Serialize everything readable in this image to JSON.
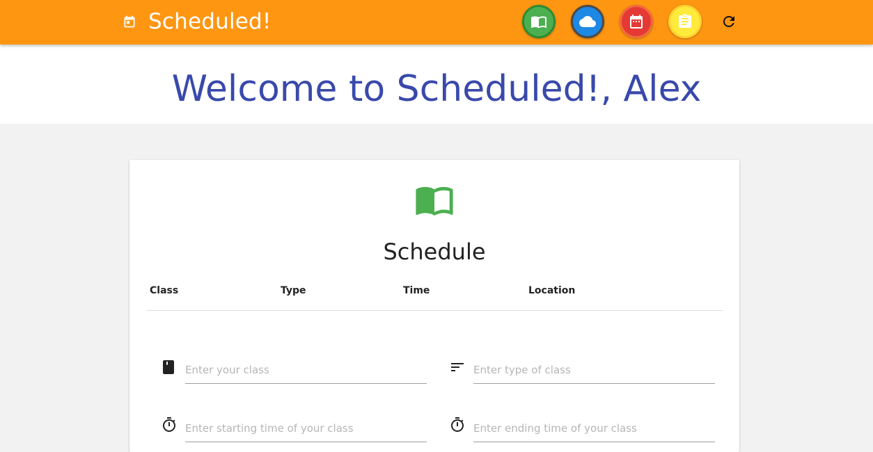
{
  "header": {
    "title": "Scheduled!",
    "nav_buttons": [
      {
        "name": "schedule",
        "icon": "book-icon",
        "color": "#4caf50"
      },
      {
        "name": "weather",
        "icon": "cloud-icon",
        "color": "#1e88e5"
      },
      {
        "name": "calendar",
        "icon": "calendar-icon",
        "color": "#e53935"
      },
      {
        "name": "notes",
        "icon": "clipboard-icon",
        "color": "#ffeb3b"
      }
    ],
    "refresh_icon": "refresh-icon",
    "bar_color": "#ff9612"
  },
  "welcome": {
    "text": "Welcome to Scheduled!, Alex",
    "color": "#3949ab"
  },
  "schedule_card": {
    "icon": "book-icon",
    "title": "Schedule",
    "columns": [
      "Class",
      "Type",
      "Time",
      "Location"
    ],
    "rows": [],
    "form": {
      "class_placeholder": "Enter your class",
      "type_placeholder": "Enter type of class",
      "start_placeholder": "Enter starting time of your class",
      "end_placeholder": "Enter ending time of your class"
    }
  }
}
